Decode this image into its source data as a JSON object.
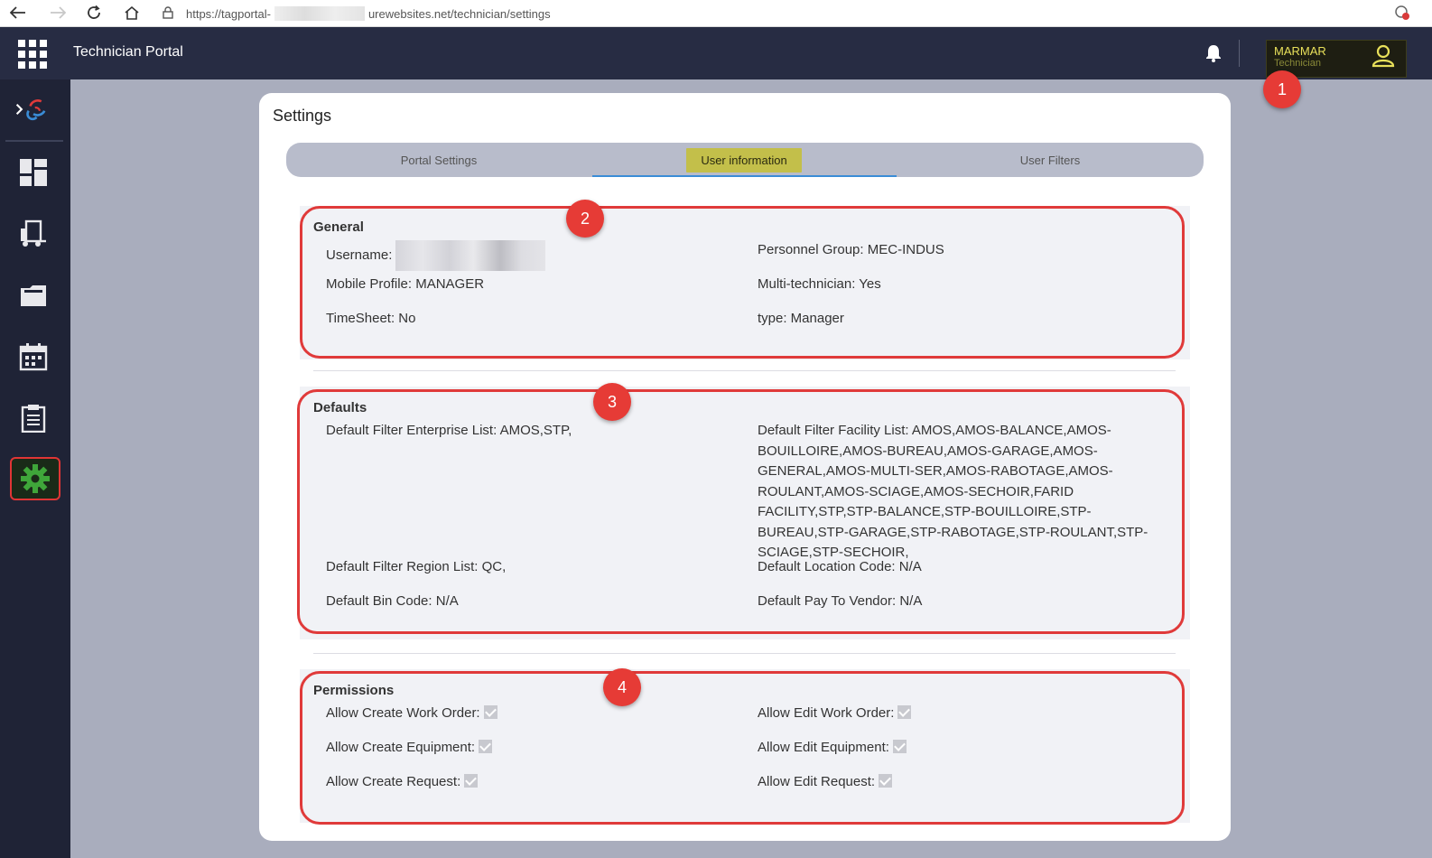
{
  "browser": {
    "url_prefix": "https://tagportal-",
    "url_suffix": "urewebsites.net/technician/settings"
  },
  "app": {
    "title": "Technician Portal",
    "user": {
      "name": "MARMAR",
      "role": "Technician"
    }
  },
  "sidebar": {
    "items": [
      {
        "name": "logo-icon"
      },
      {
        "name": "dashboard-icon"
      },
      {
        "name": "equipment-truck-icon"
      },
      {
        "name": "folder-icon"
      },
      {
        "name": "calendar-icon"
      },
      {
        "name": "clipboard-icon"
      },
      {
        "name": "gear-icon",
        "active": true
      }
    ],
    "accent_color": "#3fa63a"
  },
  "settings": {
    "title": "Settings",
    "tabs": [
      {
        "label": "Portal Settings"
      },
      {
        "label": "User information",
        "active": true
      },
      {
        "label": "User Filters"
      }
    ],
    "general": {
      "title": "General",
      "username_label": "Username:",
      "personnel_group": "Personnel Group: MEC-INDUS",
      "mobile_profile": "Mobile Profile: MANAGER",
      "multi_technician": "Multi-technician: Yes",
      "timesheet": "TimeSheet: No",
      "type": "type: Manager"
    },
    "defaults": {
      "title": "Defaults",
      "enterprise_list": "Default Filter Enterprise List: AMOS,STP,",
      "facility_list": "Default Filter Facility List: AMOS,AMOS-BALANCE,AMOS-BOUILLOIRE,AMOS-BUREAU,AMOS-GARAGE,AMOS-GENERAL,AMOS-MULTI-SER,AMOS-RABOTAGE,AMOS-ROULANT,AMOS-SCIAGE,AMOS-SECHOIR,FARID FACILITY,STP,STP-BALANCE,STP-BOUILLOIRE,STP-BUREAU,STP-GARAGE,STP-RABOTAGE,STP-ROULANT,STP-SCIAGE,STP-SECHOIR,",
      "region_list": "Default Filter Region List: QC,",
      "location_code": "Default Location Code: N/A",
      "bin_code": "Default Bin Code: N/A",
      "pay_to_vendor": "Default Pay To Vendor: N/A"
    },
    "permissions": {
      "title": "Permissions",
      "create_work_order": "Allow Create Work Order:",
      "edit_work_order": "Allow Edit Work Order:",
      "create_equipment": "Allow Create Equipment:",
      "edit_equipment": "Allow Edit Equipment:",
      "create_request": "Allow Create Request:",
      "edit_request": "Allow Edit Request:",
      "values": {
        "create_work_order": true,
        "edit_work_order": true,
        "create_equipment": true,
        "edit_equipment": true,
        "create_request": true,
        "edit_request": true
      }
    }
  },
  "annotations": {
    "badges": [
      "1",
      "2",
      "3",
      "4"
    ],
    "color": "#e03a3a"
  }
}
